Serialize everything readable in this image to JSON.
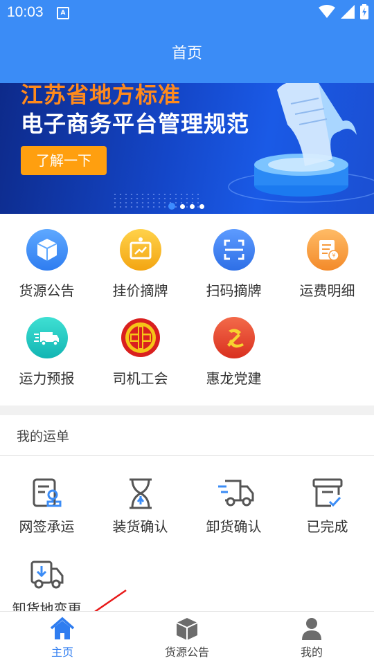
{
  "status_bar": {
    "time": "10:03",
    "notification_glyph": "A"
  },
  "header": {
    "title": "首页"
  },
  "banner": {
    "line1": "江苏省地方标准",
    "line2": "电子商务平台管理规范",
    "cta_label": "了解一下"
  },
  "menu": [
    {
      "label": "货源公告",
      "icon": "box-icon",
      "color": "#3d8ef8"
    },
    {
      "label": "挂价摘牌",
      "icon": "price-board-icon",
      "color": "#f7b21a"
    },
    {
      "label": "扫码摘牌",
      "icon": "scan-icon",
      "color": "#3d7ff2"
    },
    {
      "label": "运费明细",
      "icon": "freight-bill-icon",
      "color": "#f7993a"
    },
    {
      "label": "运力预报",
      "icon": "truck-icon",
      "color": "#1fc5c0"
    },
    {
      "label": "司机工会",
      "icon": "union-emblem-icon",
      "color": "#d9201f"
    },
    {
      "label": "惠龙党建",
      "icon": "party-emblem-icon",
      "color": "#e54630"
    }
  ],
  "orders_section": {
    "title": "我的运单",
    "items": [
      {
        "label": "网签承运",
        "icon": "contract-sign-icon"
      },
      {
        "label": "装货确认",
        "icon": "hourglass-icon"
      },
      {
        "label": "卸货确认",
        "icon": "delivery-truck-icon"
      },
      {
        "label": "已完成",
        "icon": "completed-box-icon"
      },
      {
        "label": "卸货地变更",
        "icon": "unload-change-truck-icon"
      }
    ]
  },
  "tabbar": [
    {
      "label": "主页",
      "icon": "home-icon",
      "active": true
    },
    {
      "label": "货源公告",
      "icon": "cube-icon",
      "active": false
    },
    {
      "label": "我的",
      "icon": "user-icon",
      "active": false
    }
  ],
  "colors": {
    "primary": "#3b8cf6",
    "accent": "#ff9f0f",
    "active_tab": "#2f7df0"
  }
}
